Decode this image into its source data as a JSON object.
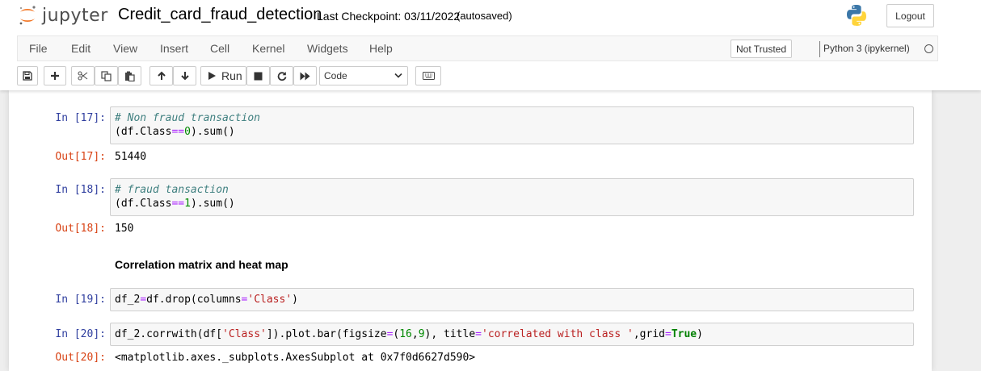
{
  "header": {
    "logo_text": "jupyter",
    "notebook_title": "Credit_card_fraud_detection",
    "checkpoint": "Last Checkpoint: 03/11/2022",
    "autosave": "(autosaved)",
    "logout_label": "Logout"
  },
  "menubar": {
    "items": [
      "File",
      "Edit",
      "View",
      "Insert",
      "Cell",
      "Kernel",
      "Widgets",
      "Help"
    ],
    "trust_label": "Not Trusted",
    "kernel_name": "Python 3 (ipykernel)"
  },
  "toolbar": {
    "run_label": "Run",
    "cell_type": "Code",
    "icons": [
      "save-icon",
      "plus-icon",
      "cut-icon",
      "copy-icon",
      "paste-icon",
      "arrow-up-icon",
      "arrow-down-icon",
      "play-icon",
      "stop-icon",
      "restart-icon",
      "fast-forward-icon",
      "keyboard-icon"
    ]
  },
  "cells": {
    "c17": {
      "in_prompt": "In [17]:",
      "line1": "# Non fraud transaction",
      "l2_a": "(df.Class",
      "l2_op": "==",
      "l2_num": "0",
      "l2_b": ").sum()",
      "out_prompt": "Out[17]:",
      "output": "51440"
    },
    "c18": {
      "in_prompt": "In [18]:",
      "line1": "# fraud tansaction",
      "l2_a": "(df.Class",
      "l2_op": "==",
      "l2_num": "1",
      "l2_b": ").sum()",
      "out_prompt": "Out[18]:",
      "output": "150"
    },
    "md": {
      "heading": "Correlation matrix and heat map"
    },
    "c19": {
      "in_prompt": "In [19]:",
      "a": "df_2",
      "op": "=",
      "b": "df.drop(columns",
      "op2": "=",
      "str": "'Class'",
      "c": ")"
    },
    "c20": {
      "in_prompt": "In [20]:",
      "a": "df_2.corrwith(df[",
      "str1": "'Class'",
      "b": "]).plot.bar(figsize",
      "op1": "=",
      "c": "(",
      "n1": "16",
      "d": ",",
      "n2": "9",
      "e": "), title",
      "op2": "=",
      "str2": "'correlated with class '",
      "f": ",grid",
      "op3": "=",
      "kw": "True",
      "g": ")",
      "out_prompt": "Out[20]:",
      "output": "<matplotlib.axes._subplots.AxesSubplot at 0x7f0d6627d590>"
    }
  }
}
